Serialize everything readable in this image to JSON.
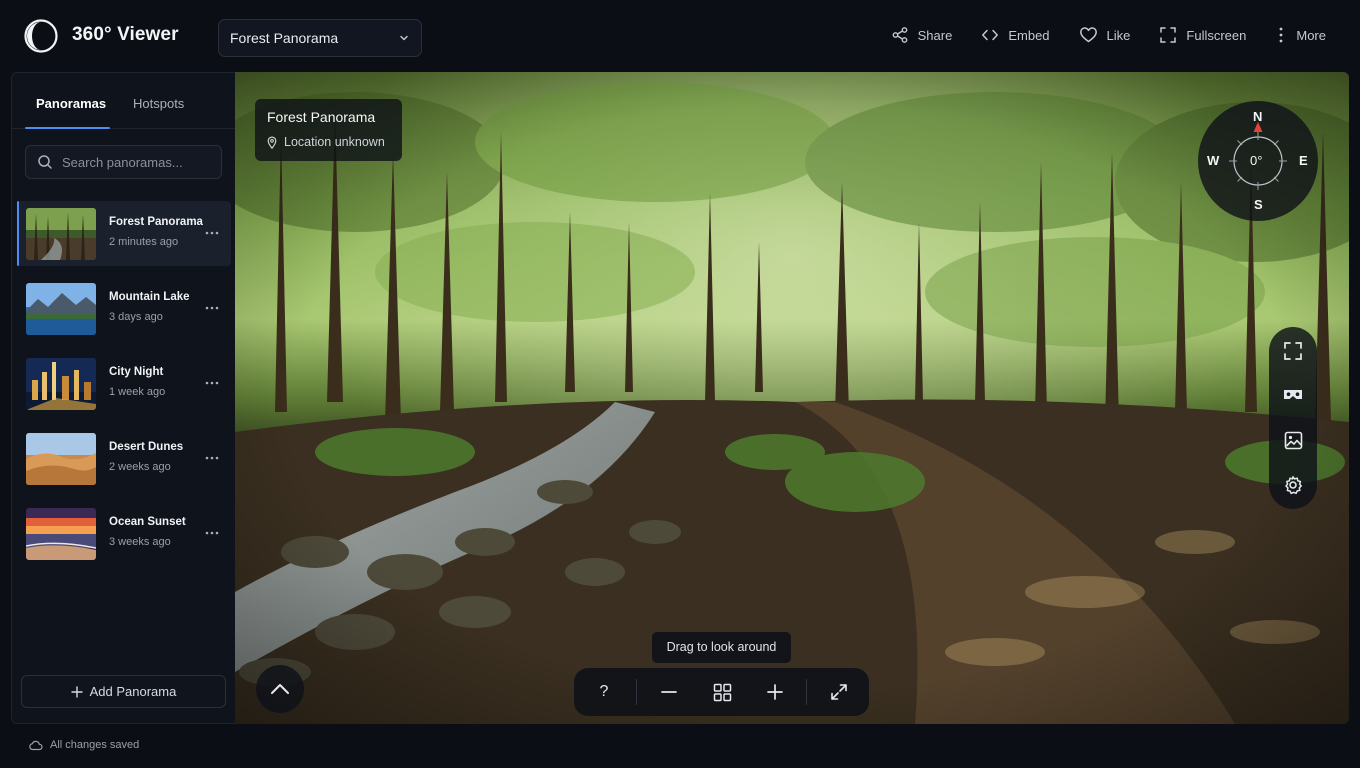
{
  "app": {
    "title": "360° Viewer",
    "selected_panorama": "Forest Panorama"
  },
  "header": {
    "actions": [
      {
        "label": "Share",
        "icon": "share-icon"
      },
      {
        "label": "Embed",
        "icon": "code-icon"
      },
      {
        "label": "Like",
        "icon": "heart-icon"
      },
      {
        "label": "Fullscreen",
        "icon": "fullscreen-icon"
      },
      {
        "label": "More",
        "icon": "more-vertical-icon"
      }
    ]
  },
  "sidebar": {
    "tabs": [
      {
        "label": "Panoramas",
        "active": true
      },
      {
        "label": "Hotspots",
        "active": false
      }
    ],
    "search": {
      "placeholder": "Search panoramas..."
    },
    "items": [
      {
        "name": "Forest Panorama",
        "time": "2 minutes ago",
        "active": true
      },
      {
        "name": "Mountain Lake",
        "time": "3 days ago",
        "active": false
      },
      {
        "name": "City Night",
        "time": "1 week ago",
        "active": false
      },
      {
        "name": "Desert Dunes",
        "time": "2 weeks ago",
        "active": false
      },
      {
        "name": "Ocean Sunset",
        "time": "3 weeks ago",
        "active": false
      }
    ],
    "add_label": "Add Panorama"
  },
  "status": {
    "text": "All changes saved",
    "icon": "cloud-check-icon"
  },
  "viewer": {
    "info": {
      "title": "Forest Panorama",
      "location": "Location unknown"
    },
    "compass": {
      "heading": "0°",
      "north": "N",
      "south": "S",
      "east": "E",
      "west": "W"
    },
    "tooltip": "Drag to look around",
    "side_tools": [
      "fullscreen-icon",
      "vr-headset-icon",
      "image-icon",
      "settings-icon"
    ],
    "bottom_tools": [
      "help-icon",
      "zoom-out-icon",
      "grid-icon",
      "zoom-in-icon",
      "expand-icon"
    ],
    "help_label": "?"
  },
  "colors": {
    "accent": "#4f8df5",
    "background": "#0b0e14",
    "panel": "#0f131b",
    "compass_north": "#e0453a"
  }
}
